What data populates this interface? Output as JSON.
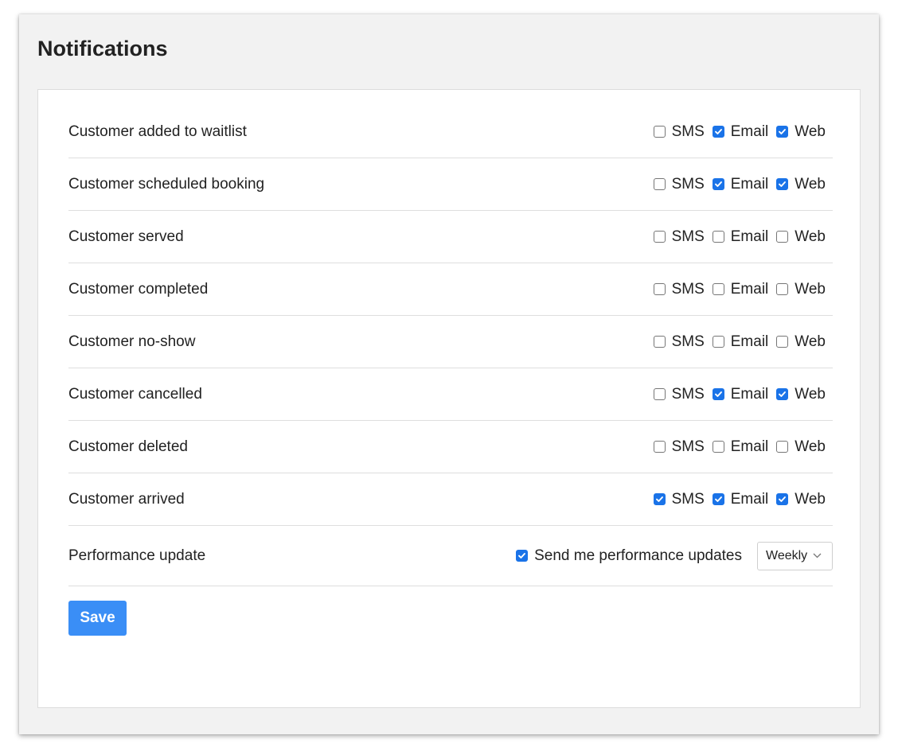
{
  "page": {
    "title": "Notifications"
  },
  "notifications": {
    "rows": [
      {
        "label": "Customer added to waitlist",
        "sms": false,
        "email": true,
        "web": true
      },
      {
        "label": "Customer scheduled booking",
        "sms": false,
        "email": true,
        "web": true
      },
      {
        "label": "Customer served",
        "sms": false,
        "email": false,
        "web": false
      },
      {
        "label": "Customer completed",
        "sms": false,
        "email": false,
        "web": false
      },
      {
        "label": "Customer no-show",
        "sms": false,
        "email": false,
        "web": false
      },
      {
        "label": "Customer cancelled",
        "sms": false,
        "email": true,
        "web": true
      },
      {
        "label": "Customer deleted",
        "sms": false,
        "email": false,
        "web": false
      },
      {
        "label": "Customer arrived",
        "sms": true,
        "email": true,
        "web": true
      }
    ],
    "channel_labels": {
      "sms": "SMS",
      "email": "Email",
      "web": "Web"
    }
  },
  "performance": {
    "label": "Performance update",
    "checkbox_label": "Send me performance updates",
    "checked": true,
    "frequency_selected": "Weekly"
  },
  "actions": {
    "save_label": "Save"
  },
  "colors": {
    "accent": "#1a73e8",
    "save_button": "#3a8ef6",
    "panel_background": "#f2f2f2"
  },
  "icons": {
    "checkbox_check": "check-icon",
    "select_chevron": "chevron-down-icon"
  }
}
